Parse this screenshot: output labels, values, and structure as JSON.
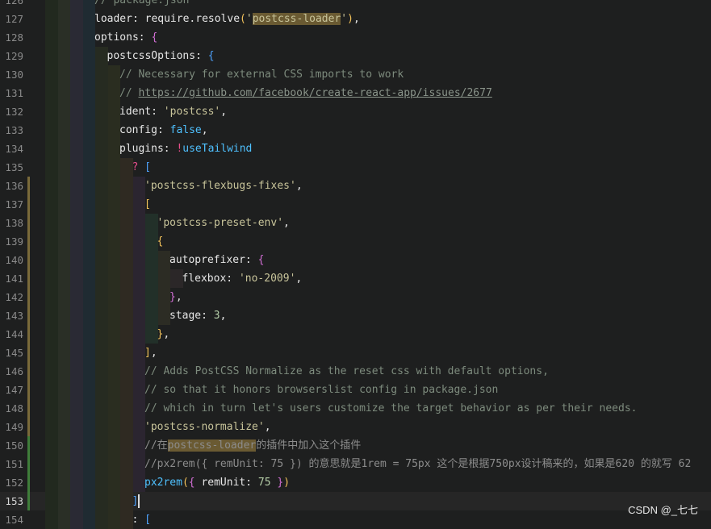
{
  "editor": {
    "current_line": 153,
    "lines": [
      {
        "n": "126",
        "tokens": [
          {
            "t": "// package.json",
            "c": "cm"
          }
        ]
      },
      {
        "n": "127",
        "tokens": [
          {
            "t": "loader",
            "c": "id"
          },
          {
            "t": ":",
            "c": "id"
          },
          {
            "t": " ",
            "c": "ws"
          },
          {
            "t": "require",
            "c": "id"
          },
          {
            "t": ".",
            "c": "id"
          },
          {
            "t": "resolve",
            "c": "id"
          },
          {
            "t": "(",
            "c": "b1"
          },
          {
            "t": "'",
            "c": "str"
          },
          {
            "t": "postcss-loader",
            "c": "str hl"
          },
          {
            "t": "'",
            "c": "str"
          },
          {
            "t": ")",
            "c": "b1"
          },
          {
            "t": ",",
            "c": "id"
          }
        ]
      },
      {
        "n": "128",
        "tokens": [
          {
            "t": "options",
            "c": "id"
          },
          {
            "t": ":",
            "c": "id"
          },
          {
            "t": " ",
            "c": "ws"
          },
          {
            "t": "{",
            "c": "b2"
          }
        ]
      },
      {
        "n": "129",
        "tokens": [
          {
            "t": "postcssOptions",
            "c": "id"
          },
          {
            "t": ":",
            "c": "id"
          },
          {
            "t": " ",
            "c": "ws"
          },
          {
            "t": "{",
            "c": "b3"
          }
        ]
      },
      {
        "n": "130",
        "tokens": [
          {
            "t": "//",
            "c": "cm"
          },
          {
            "t": " Necessary for external CSS imports to work",
            "c": "cm"
          }
        ]
      },
      {
        "n": "131",
        "tokens": [
          {
            "t": "//",
            "c": "cm"
          },
          {
            "t": " ",
            "c": "cm"
          },
          {
            "t": "https://github.com/facebook/create-react-app/issues/2677",
            "c": "url"
          }
        ]
      },
      {
        "n": "132",
        "tokens": [
          {
            "t": "ident",
            "c": "id"
          },
          {
            "t": ":",
            "c": "id"
          },
          {
            "t": " ",
            "c": "ws"
          },
          {
            "t": "'postcss'",
            "c": "str"
          },
          {
            "t": ",",
            "c": "id"
          }
        ]
      },
      {
        "n": "133",
        "tokens": [
          {
            "t": "config",
            "c": "id"
          },
          {
            "t": ":",
            "c": "id"
          },
          {
            "t": " ",
            "c": "ws"
          },
          {
            "t": "false",
            "c": "kw"
          },
          {
            "t": ",",
            "c": "id"
          }
        ]
      },
      {
        "n": "134",
        "tokens": [
          {
            "t": "plugins",
            "c": "id"
          },
          {
            "t": ":",
            "c": "id"
          },
          {
            "t": " ",
            "c": "ws"
          },
          {
            "t": "!",
            "c": "bm"
          },
          {
            "t": "useTailwind",
            "c": "kw"
          }
        ]
      },
      {
        "n": "135",
        "tokens": [
          {
            "t": "?",
            "c": "bm"
          },
          {
            "t": " ",
            "c": "ws"
          },
          {
            "t": "[",
            "c": "b3"
          }
        ]
      },
      {
        "n": "136",
        "tokens": [
          {
            "t": "'postcss-flexbugs-fixes'",
            "c": "str"
          },
          {
            "t": ",",
            "c": "id"
          }
        ]
      },
      {
        "n": "137",
        "tokens": [
          {
            "t": "[",
            "c": "b1"
          }
        ]
      },
      {
        "n": "138",
        "tokens": [
          {
            "t": "'postcss-preset-env'",
            "c": "str"
          },
          {
            "t": ",",
            "c": "id"
          }
        ]
      },
      {
        "n": "139",
        "tokens": [
          {
            "t": "{",
            "c": "b1"
          }
        ]
      },
      {
        "n": "140",
        "tokens": [
          {
            "t": "autoprefixer",
            "c": "id"
          },
          {
            "t": ":",
            "c": "id"
          },
          {
            "t": " ",
            "c": "ws"
          },
          {
            "t": "{",
            "c": "b2"
          }
        ]
      },
      {
        "n": "141",
        "tokens": [
          {
            "t": "flexbox",
            "c": "id"
          },
          {
            "t": ":",
            "c": "id"
          },
          {
            "t": " ",
            "c": "ws"
          },
          {
            "t": "'no-2009'",
            "c": "str"
          },
          {
            "t": ",",
            "c": "id"
          }
        ]
      },
      {
        "n": "142",
        "tokens": [
          {
            "t": "}",
            "c": "b2"
          },
          {
            "t": ",",
            "c": "id"
          }
        ]
      },
      {
        "n": "143",
        "tokens": [
          {
            "t": "stage",
            "c": "id"
          },
          {
            "t": ":",
            "c": "id"
          },
          {
            "t": " ",
            "c": "ws"
          },
          {
            "t": "3",
            "c": "num"
          },
          {
            "t": ",",
            "c": "id"
          }
        ]
      },
      {
        "n": "144",
        "tokens": [
          {
            "t": "}",
            "c": "b1"
          },
          {
            "t": ",",
            "c": "id"
          }
        ]
      },
      {
        "n": "145",
        "tokens": [
          {
            "t": "]",
            "c": "b1"
          },
          {
            "t": ",",
            "c": "id"
          }
        ]
      },
      {
        "n": "146",
        "tokens": [
          {
            "t": "// Adds PostCSS Normalize as the reset css with default options,",
            "c": "cm"
          }
        ]
      },
      {
        "n": "147",
        "tokens": [
          {
            "t": "// so that it honors browserslist config in package.json",
            "c": "cm"
          }
        ]
      },
      {
        "n": "148",
        "tokens": [
          {
            "t": "// which in turn let's users customize the target behavior as per their needs.",
            "c": "cm"
          }
        ]
      },
      {
        "n": "149",
        "tokens": [
          {
            "t": "'postcss-normalize'",
            "c": "str"
          },
          {
            "t": ",",
            "c": "id"
          }
        ]
      },
      {
        "n": "150",
        "tokens": [
          {
            "t": "//在",
            "c": "cj"
          },
          {
            "t": "postcss-loader",
            "c": "cj hl"
          },
          {
            "t": "的插件中加入这个插件",
            "c": "cj"
          }
        ]
      },
      {
        "n": "151",
        "tokens": [
          {
            "t": "//px2rem({ remUnit: 75 }) 的意思就是1rem = 75px 这个是根据750px设计稿来的，如果是620 的就写 62",
            "c": "cj"
          }
        ]
      },
      {
        "n": "152",
        "tokens": [
          {
            "t": "px2rem",
            "c": "kw"
          },
          {
            "t": "(",
            "c": "b1"
          },
          {
            "t": "{",
            "c": "b2"
          },
          {
            "t": " ",
            "c": "ws"
          },
          {
            "t": "remUnit",
            "c": "id"
          },
          {
            "t": ":",
            "c": "id"
          },
          {
            "t": " ",
            "c": "ws"
          },
          {
            "t": "75",
            "c": "num"
          },
          {
            "t": " ",
            "c": "ws"
          },
          {
            "t": "}",
            "c": "b2"
          },
          {
            "t": ")",
            "c": "b1"
          }
        ]
      },
      {
        "n": "153",
        "tokens": [
          {
            "t": "]",
            "c": "b3"
          }
        ]
      },
      {
        "n": "154",
        "tokens": [
          {
            "t": ":",
            "c": "id"
          },
          {
            "t": " ",
            "c": "ws"
          },
          {
            "t": "[",
            "c": "b3"
          }
        ]
      }
    ]
  },
  "guide_colors": [
    "#22291f",
    "#2a2f26",
    "#2a2a34",
    "#1f2b32",
    "#262b21",
    "#2a2d20",
    "#2f2a22",
    "#2b2530",
    "#223029",
    "#2c2c24",
    "#2b2728",
    "#2a3024"
  ],
  "watermark": "CSDN @_七七"
}
